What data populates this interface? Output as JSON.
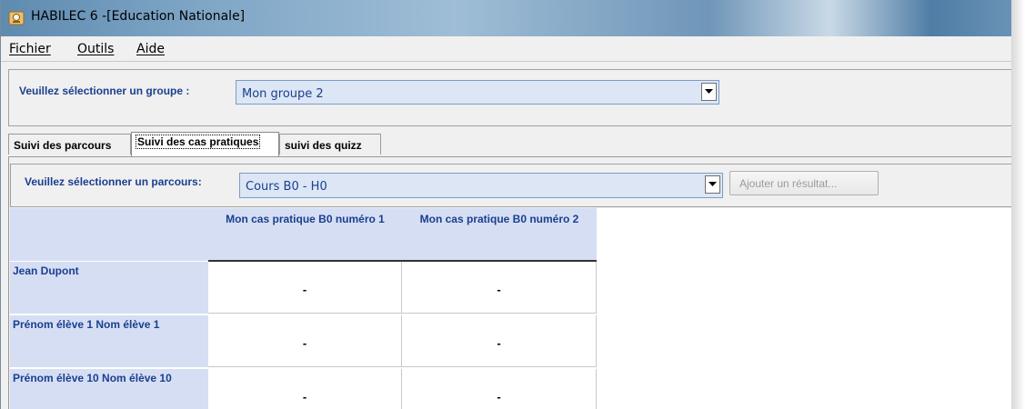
{
  "window": {
    "title": "HABILEC 6 -[Education Nationale]"
  },
  "menu": {
    "items": [
      "Fichier",
      "Outils",
      "Aide"
    ]
  },
  "group_selector": {
    "label": "Veuillez sélectionner un groupe :",
    "value": "Mon groupe 2"
  },
  "tabs": [
    {
      "label": "Suivi des parcours",
      "active": false
    },
    {
      "label": "Suivi des cas pratiques",
      "active": true
    },
    {
      "label": "suivi des quizz",
      "active": false
    }
  ],
  "parcours_selector": {
    "label": "Veuillez sélectionner un parcours:",
    "value": "Cours B0 - H0",
    "add_button": "Ajouter un résultat..."
  },
  "grid": {
    "columns": [
      "Mon cas pratique B0 numéro 1",
      "Mon cas pratique B0 numéro 2"
    ],
    "rows": [
      {
        "name": "Jean Dupont",
        "values": [
          "-",
          "-"
        ]
      },
      {
        "name": "Prénom élève 1 Nom élève 1",
        "values": [
          "-",
          "-"
        ]
      },
      {
        "name": "Prénom élève 10 Nom élève 10",
        "values": [
          "-",
          "-"
        ]
      }
    ]
  },
  "colors": {
    "label_blue": "#1a3f8f",
    "header_fill": "#d6def4",
    "combo_fill": "#dce6f4"
  }
}
